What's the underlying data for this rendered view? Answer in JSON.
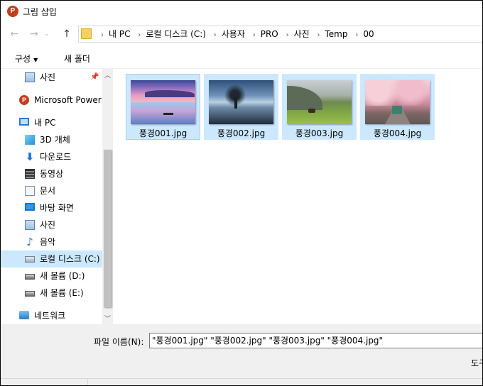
{
  "window": {
    "title": "그림 삽입",
    "app_icon_letter": "P"
  },
  "address": {
    "nav_back": "←",
    "nav_forward": "→",
    "nav_recent": "⌄",
    "nav_up": "↑",
    "breadcrumbs": [
      "내 PC",
      "로컬 디스크 (C:)",
      "사용자",
      "PRO",
      "사진",
      "Temp",
      "00"
    ],
    "separator": "›"
  },
  "toolbar": {
    "organize_label": "구성",
    "organize_caret": "▼",
    "new_folder_label": "새 폴더"
  },
  "nav_pane": {
    "items": [
      {
        "label": "사진",
        "icon": "pictures-icon",
        "pinned": true
      },
      {
        "label": "Microsoft PowerP",
        "icon": "powerpoint-icon"
      },
      {
        "label": "내 PC",
        "icon": "pc-icon"
      },
      {
        "label": "3D 개체",
        "icon": "3d-objects-icon"
      },
      {
        "label": "다운로드",
        "icon": "download-icon"
      },
      {
        "label": "동영상",
        "icon": "video-icon"
      },
      {
        "label": "문서",
        "icon": "document-icon"
      },
      {
        "label": "바탕 화면",
        "icon": "desktop-icon"
      },
      {
        "label": "사진",
        "icon": "pictures-icon"
      },
      {
        "label": "음악",
        "icon": "music-icon"
      },
      {
        "label": "로컬 디스크 (C:)",
        "icon": "local-disk-icon",
        "selected": true
      },
      {
        "label": "새 볼륨 (D:)",
        "icon": "drive-icon"
      },
      {
        "label": "새 볼륨 (E:)",
        "icon": "drive-icon"
      },
      {
        "label": "네트워크",
        "icon": "network-icon"
      }
    ],
    "pin_glyph": "📌",
    "scroll_up": "︿",
    "scroll_down": "﹀"
  },
  "files": [
    {
      "name": "풍경001.jpg",
      "selected": true,
      "focused": true
    },
    {
      "name": "풍경002.jpg",
      "selected": true
    },
    {
      "name": "풍경003.jpg",
      "selected": true
    },
    {
      "name": "풍경004.jpg",
      "selected": true
    }
  ],
  "bottom": {
    "filename_label": "파일 이름(N):",
    "filename_value": "\"풍경001.jpg\" \"풍경002.jpg\" \"풍경003.jpg\" \"풍경004.jpg\"",
    "tools_label": "도구"
  },
  "colors": {
    "selection": "#cce8ff",
    "selection_border": "#99d1ff",
    "powerpoint": "#c43e1c",
    "folder": "#f6d25c"
  }
}
